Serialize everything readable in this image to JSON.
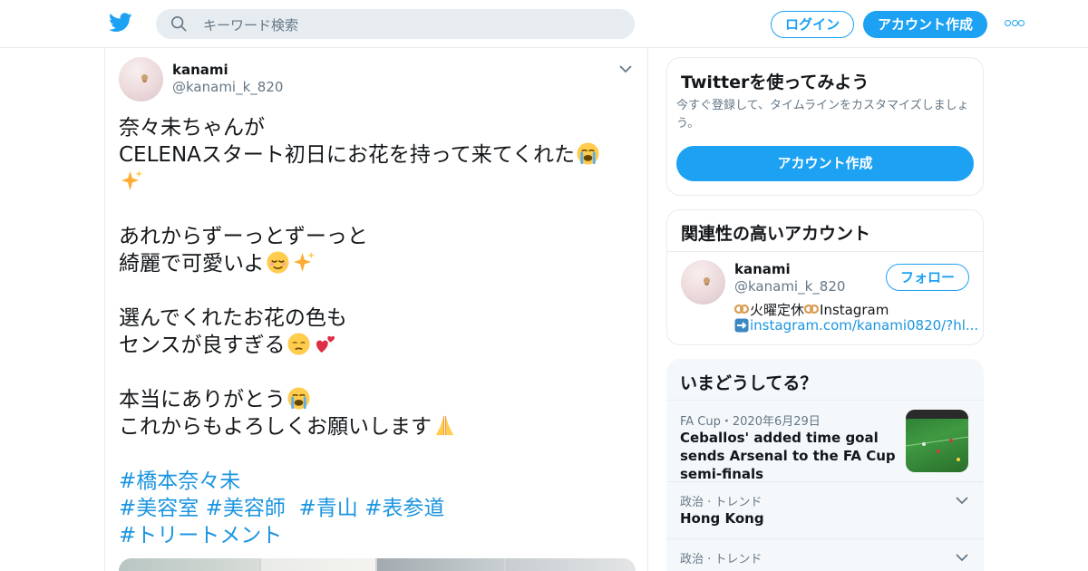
{
  "header": {
    "logo": "twitter-bird-icon",
    "search_placeholder": "キーワード検索",
    "login_label": "ログイン",
    "signup_label": "アカウント作成",
    "more_icon": "more-dots-icon",
    "accent_color": "#1da1f2"
  },
  "tweet": {
    "author_name": "kanami",
    "author_handle": "@kanami_k_820",
    "lines": [
      "奈々未ちゃんが",
      "CELENAスタート初日にお花を持って来てくれた",
      "",
      "あれからずーっとずーっと",
      "綺麗で可愛いよ",
      "",
      "選んでくれたお花の色も",
      "センスが良すぎる",
      "",
      "本当にありがとう",
      "これからもよろしくお願いします"
    ],
    "hashtags": {
      "line1": [
        "#橋本奈々未"
      ],
      "line2": [
        "#美容室",
        "#美容師",
        "#青山",
        "#表参道"
      ],
      "line3": [
        "#トリートメント"
      ]
    },
    "emojis": [
      "crying-face-icon",
      "sparkles-icon",
      "relieved-face-icon",
      "heart-eyes-face-icon",
      "two-hearts-icon",
      "folded-hands-icon"
    ]
  },
  "sidebar": {
    "signup_card": {
      "title": "Twitterを使ってみよう",
      "subtitle": "今すぐ登録して、タイムラインをカスタマイズしましょう。",
      "button": "アカウント作成"
    },
    "related": {
      "title": "関連性の高いアカウント",
      "name": "kanami",
      "handle": "@kanami_k_820",
      "follow_label": "フォロー",
      "bio_line1": "火曜定休",
      "bio_line1_suffix": "Instagram",
      "bio_link": "instagram.com/kanami0820/?hl..."
    },
    "trends": {
      "title": "いまどうしてる？",
      "items": [
        {
          "meta": "FA Cup・2020年6月29日",
          "title": "Ceballos' added time goal sends Arsenal to the FA Cup semi-finals"
        },
        {
          "meta": "政治 · トレンド",
          "title": "Hong Kong"
        },
        {
          "meta": "政治 · トレンド",
          "title": ""
        }
      ]
    }
  }
}
